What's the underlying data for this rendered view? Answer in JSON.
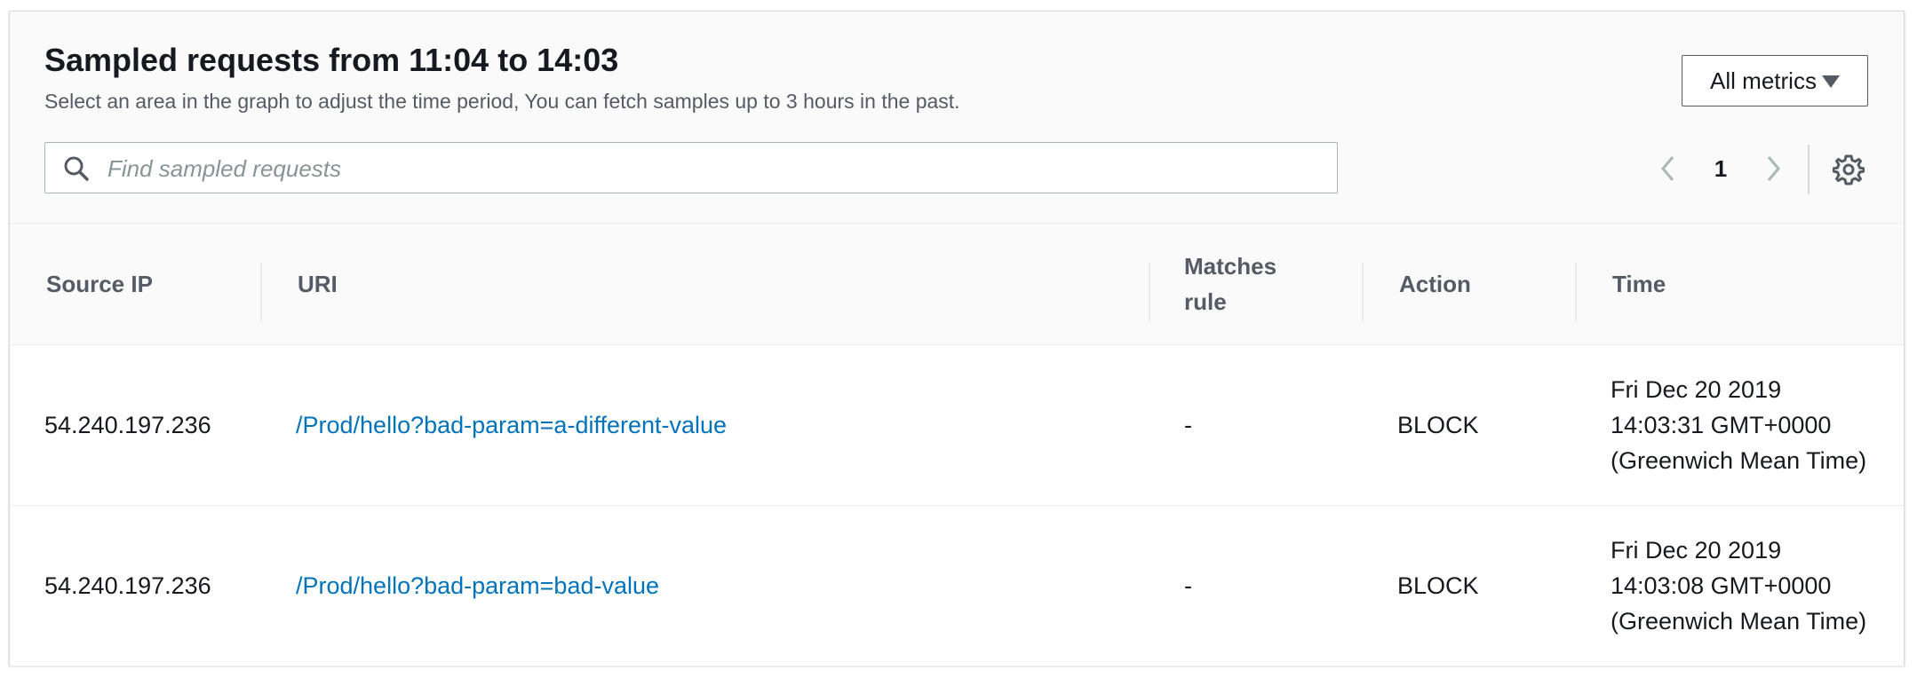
{
  "header": {
    "title": "Sampled requests from 11:04 to 14:03",
    "subtitle": "Select an area in the graph to adjust the time period, You can fetch samples up to 3 hours in the past.",
    "metrics_button": "All metrics",
    "search_placeholder": "Find sampled requests"
  },
  "pagination": {
    "current_page": "1"
  },
  "table": {
    "columns": {
      "source_ip": "Source IP",
      "uri": "URI",
      "matches_rule": "Matches rule",
      "action": "Action",
      "time": "Time"
    },
    "rows": [
      {
        "source_ip": "54.240.197.236",
        "uri": "/Prod/hello?bad-param=a-different-value",
        "matches_rule": "-",
        "action": "BLOCK",
        "time": "Fri Dec 20 2019 14:03:31 GMT+0000 (Greenwich Mean Time)"
      },
      {
        "source_ip": "54.240.197.236",
        "uri": "/Prod/hello?bad-param=bad-value",
        "matches_rule": "-",
        "action": "BLOCK",
        "time": "Fri Dec 20 2019 14:03:08 GMT+0000 (Greenwich Mean Time)"
      }
    ]
  },
  "icons": {
    "search": "search-icon",
    "caret": "caret-down-icon",
    "prev": "chevron-left-icon",
    "next": "chevron-right-icon",
    "settings": "gear-icon"
  },
  "colors": {
    "link": "#0073bb",
    "header_bg": "#fafafa",
    "border": "#d5dbdb",
    "text_secondary": "#545b64"
  }
}
